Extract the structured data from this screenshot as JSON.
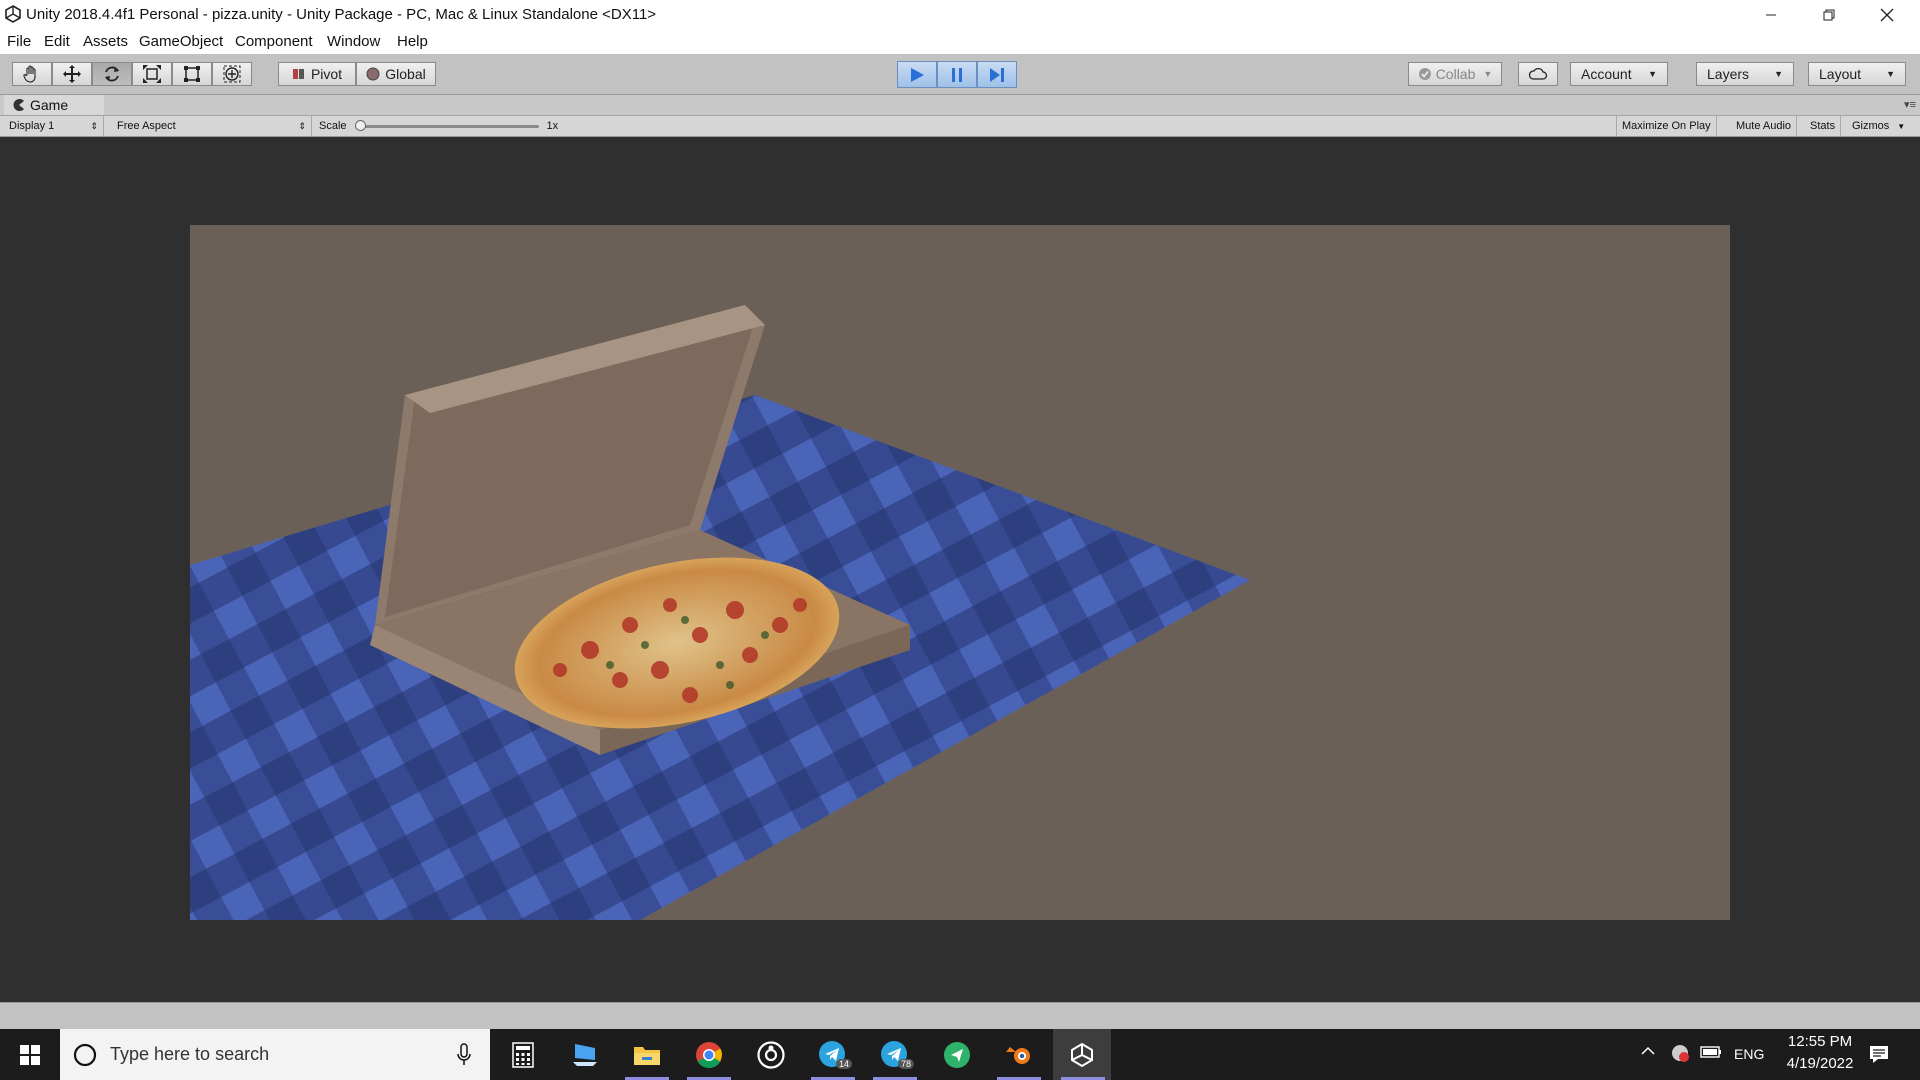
{
  "window": {
    "title": "Unity 2018.4.4f1 Personal - pizza.unity - Unity Package - PC, Mac & Linux Standalone <DX11>",
    "controls": [
      "minimize",
      "restore",
      "close"
    ]
  },
  "menu": [
    "File",
    "Edit",
    "Assets",
    "GameObject",
    "Component",
    "Window",
    "Help"
  ],
  "toolbar": {
    "tools": [
      "hand-tool",
      "move-tool",
      "rotate-tool",
      "scale-tool",
      "rect-tool",
      "transform-tool"
    ],
    "active_tool": "rotate-tool",
    "pivot_label": "Pivot",
    "global_label": "Global",
    "play_state": "playing",
    "collab_label": "Collab",
    "account_label": "Account",
    "layers_label": "Layers",
    "layout_label": "Layout"
  },
  "game_tab": {
    "label": "Game"
  },
  "game_bar": {
    "display": "Display 1",
    "aspect": "Free Aspect",
    "scale_label": "Scale",
    "scale_value": "1x",
    "scale_fraction": 0.0,
    "maximize": "Maximize On Play",
    "mute": "Mute Audio",
    "stats": "Stats",
    "gizmos": "Gizmos"
  },
  "scene": {
    "background_color": "#6b6058",
    "tablecloth_color": "#3a4f8f",
    "box_color": "#8a7868",
    "objects": [
      "tablecloth",
      "pizza-box",
      "pizza"
    ]
  },
  "taskbar": {
    "search_placeholder": "Type here to search",
    "apps": [
      "calculator",
      "pc-app",
      "file-explorer",
      "chrome",
      "obs",
      "telegram",
      "telegram-2",
      "green-app",
      "blender",
      "unity"
    ],
    "telegram_badge": "14",
    "telegram2_badge": "78",
    "language": "ENG",
    "time": "12:55 PM",
    "date": "4/19/2022"
  }
}
